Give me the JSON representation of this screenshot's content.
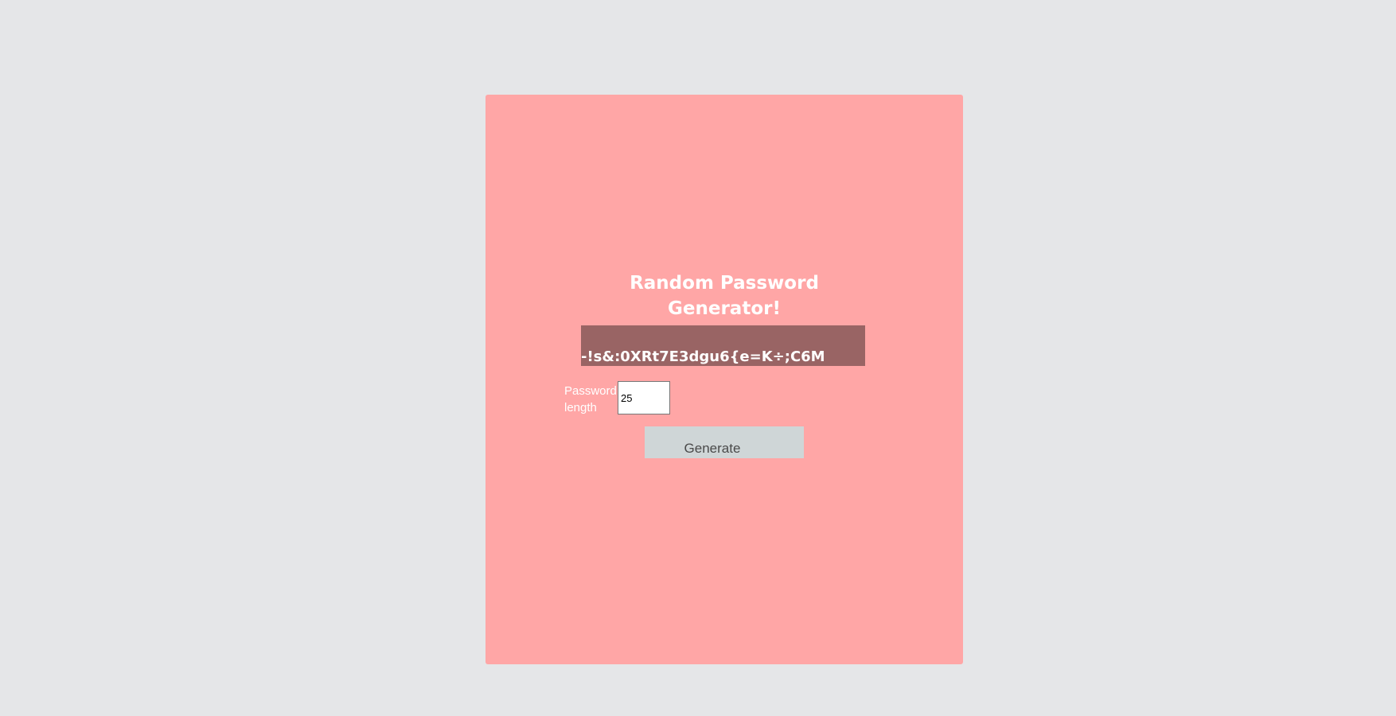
{
  "app": {
    "title_line1": "Random Password",
    "title_line2": "Generator!"
  },
  "output": {
    "password": "-!s&:0XRt7E3dgu6{e=K÷;C6M"
  },
  "length": {
    "label_line1": "Password",
    "label_line2": "length",
    "value": "25"
  },
  "actions": {
    "generate_label": "Generate"
  },
  "colors": {
    "background": "#e5e6e8",
    "card": "#ffa6a6",
    "output_box": "#996464",
    "button": "#cfd6d7"
  }
}
